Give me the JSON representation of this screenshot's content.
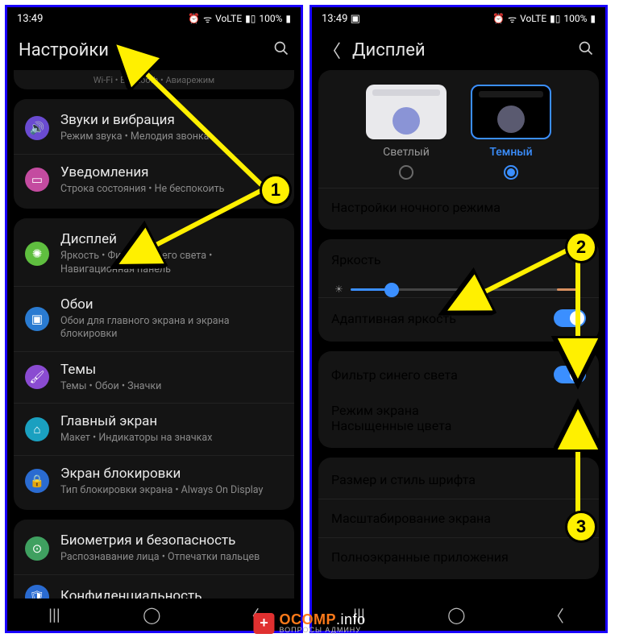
{
  "status": {
    "time": "13:49",
    "battery": "100%",
    "net": "VoLTE"
  },
  "screen1": {
    "title": "Настройки",
    "truncated_hint": "Wi-Fi  •  Bluetooth  •  Авиарежим",
    "items": [
      {
        "icon_name": "sound-icon",
        "color": "#6a4bd1",
        "glyph": "🔊",
        "label": "Звуки и вибрация",
        "sub": "Режим звука  •  Мелодия звонка"
      },
      {
        "icon_name": "notif-icon",
        "color": "#c44ba0",
        "glyph": "▭",
        "label": "Уведомления",
        "sub": "Строка состояния  •  Не беспокоить"
      },
      {
        "icon_name": "display-icon",
        "color": "#5fbf3f",
        "glyph": "✺",
        "label": "Дисплей",
        "sub": "Яркость  •  Фильтр синего света  •  Навигационная панель"
      },
      {
        "icon_name": "wallpaper-icon",
        "color": "#2a7bd1",
        "glyph": "▣",
        "label": "Обои",
        "sub": "Обои для главного экрана и экрана блокировки"
      },
      {
        "icon_name": "themes-icon",
        "color": "#8a4bd1",
        "glyph": "🖌",
        "label": "Темы",
        "sub": "Темы  •  Обои  •  Значки"
      },
      {
        "icon_name": "home-icon",
        "color": "#1aa0c0",
        "glyph": "⌂",
        "label": "Главный экран",
        "sub": "Макет  •  Индикаторы на значках"
      },
      {
        "icon_name": "lock-icon",
        "color": "#2a6bd1",
        "glyph": "🔒",
        "label": "Экран блокировки",
        "sub": "Тип блокировки экрана  •  Always On Display"
      },
      {
        "icon_name": "biometric-icon",
        "color": "#3fa060",
        "glyph": "⊙",
        "label": "Биометрия и безопасность",
        "sub": "Распознавание лица  •  Отпечатки пальцев"
      },
      {
        "icon_name": "privacy-icon",
        "color": "#2a6bd1",
        "glyph": "🛡",
        "label": "Конфиденциальность",
        "sub": ""
      }
    ]
  },
  "screen2": {
    "title": "Дисплей",
    "theme_light": "Светлый",
    "theme_dark": "Темный",
    "night_mode": "Настройки ночного режима",
    "brightness_label": "Яркость",
    "brightness_percent": 18,
    "adaptive": "Адаптивная яркость",
    "bluefilter": "Фильтр синего света",
    "screenmode_label": "Режим экрана",
    "screenmode_value": "Насыщенные цвета",
    "fontsize": "Размер и стиль шрифта",
    "scaling": "Масштабирование экрана",
    "fullscreen_apps": "Полноэкранные приложения"
  },
  "annotations": {
    "1": "1",
    "2": "2",
    "3": "3"
  },
  "watermark": {
    "brand": "OCOMP",
    "suffix": ".info",
    "tagline": "ВОПРОСЫ АДМИНУ"
  }
}
